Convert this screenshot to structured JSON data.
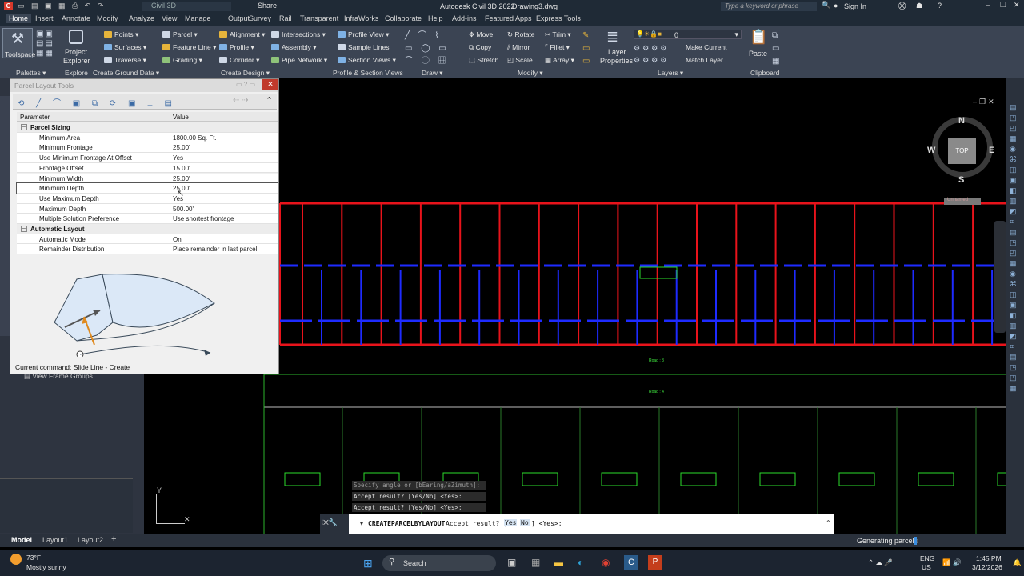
{
  "titlebar": {
    "workspace": "Civil 3D",
    "share": "Share",
    "app_title": "Autodesk Civil 3D 2022",
    "drawing": "Drawing3.dwg",
    "search_placeholder": "Type a keyword or phrase",
    "signin": "Sign In"
  },
  "tabs": [
    "Home",
    "Insert",
    "Annotate",
    "Modify",
    "Analyze",
    "View",
    "Manage",
    "Output",
    "Survey",
    "Rail",
    "Transparent",
    "InfraWorks",
    "Collaborate",
    "Help",
    "Add-ins",
    "Featured Apps",
    "Express Tools"
  ],
  "ribbon": {
    "toolspace": "Toolspace",
    "project_explorer_1": "Project",
    "project_explorer_2": "Explorer",
    "points": "Points",
    "surfaces": "Surfaces",
    "traverse": "Traverse",
    "parcel": "Parcel",
    "feature_line": "Feature Line",
    "grading": "Grading",
    "alignment": "Alignment",
    "profile": "Profile",
    "corridor": "Corridor",
    "intersections": "Intersections",
    "assembly": "Assembly",
    "pipe_network": "Pipe Network",
    "profile_view": "Profile View",
    "sample_lines": "Sample Lines",
    "section_views": "Section Views",
    "move": "Move",
    "rotate": "Rotate",
    "trim": "Trim",
    "copy": "Copy",
    "mirror": "Mirror",
    "fillet": "Fillet",
    "stretch": "Stretch",
    "scale": "Scale",
    "array": "Array",
    "layer_props_1": "Layer",
    "layer_props_2": "Properties",
    "layer_value": "0",
    "make_current": "Make Current",
    "match_layer": "Match Layer",
    "paste": "Paste",
    "panels": [
      "Palettes",
      "Explore",
      "Create Ground Data",
      "Create Design",
      "Profile & Section Views",
      "Draw",
      "Modify",
      "Layers",
      "Clipboard"
    ]
  },
  "dialog": {
    "title": "Parcel Layout Tools",
    "col_param": "Parameter",
    "col_value": "Value",
    "rows": [
      {
        "cat": true,
        "name": "Parcel Sizing",
        "value": ""
      },
      {
        "cat": false,
        "name": "Minimum Area",
        "value": "1800.00 Sq. Ft."
      },
      {
        "cat": false,
        "name": "Minimum Frontage",
        "value": "25.00'"
      },
      {
        "cat": false,
        "name": "Use Minimum Frontage At Offset",
        "value": "Yes"
      },
      {
        "cat": false,
        "name": "Frontage Offset",
        "value": "15.00'"
      },
      {
        "cat": false,
        "name": "Minimum Width",
        "value": "25.00'"
      },
      {
        "cat": false,
        "name": "Minimum Depth",
        "value": "25.00'"
      },
      {
        "cat": false,
        "name": "Use Maximum Depth",
        "value": "Yes"
      },
      {
        "cat": false,
        "name": "Maximum Depth",
        "value": "500.00'"
      },
      {
        "cat": false,
        "name": "Multiple Solution Preference",
        "value": "Use shortest frontage"
      },
      {
        "cat": true,
        "name": "Automatic Layout",
        "value": ""
      },
      {
        "cat": false,
        "name": "Automatic Mode",
        "value": "On"
      },
      {
        "cat": false,
        "name": "Remainder Distribution",
        "value": "Place remainder in last parcel"
      }
    ],
    "current_command": "Current command: Slide Line - Create"
  },
  "leftpanel": {
    "view_frame_groups": "View Frame Groups"
  },
  "viewcube": {
    "n": "N",
    "s": "S",
    "e": "E",
    "w": "W",
    "top": "TOP"
  },
  "canvas": {
    "unnamed": "Unnamed",
    "road3": "Road : 3",
    "road4": "Road : 4"
  },
  "command": {
    "hist": [
      "Specify angle or [bEaring/aZimuth]:",
      "Accept result? [Yes/No] <Yes>:",
      "Accept result? [Yes/No] <Yes>:"
    ],
    "prompt_cmd": "CREATEPARCELBYLAYOUT",
    "prompt_text": "Accept result? [",
    "opt_yes": "Yes",
    "opt_no": "No",
    "prompt_end": "] <Yes>:"
  },
  "layouts": [
    "Model",
    "Layout1",
    "Layout2"
  ],
  "status": {
    "generating": "Generating parcels"
  },
  "taskbar": {
    "temp": "73°F",
    "weather": "Mostly sunny",
    "search": "Search",
    "lang1": "ENG",
    "lang2": "US",
    "time": "1:45 PM",
    "date": "3/12/2026"
  },
  "colors": {
    "parcel_red": "#e8131b",
    "road_blue": "#1e2bff",
    "label_green": "#2bdc2b"
  }
}
